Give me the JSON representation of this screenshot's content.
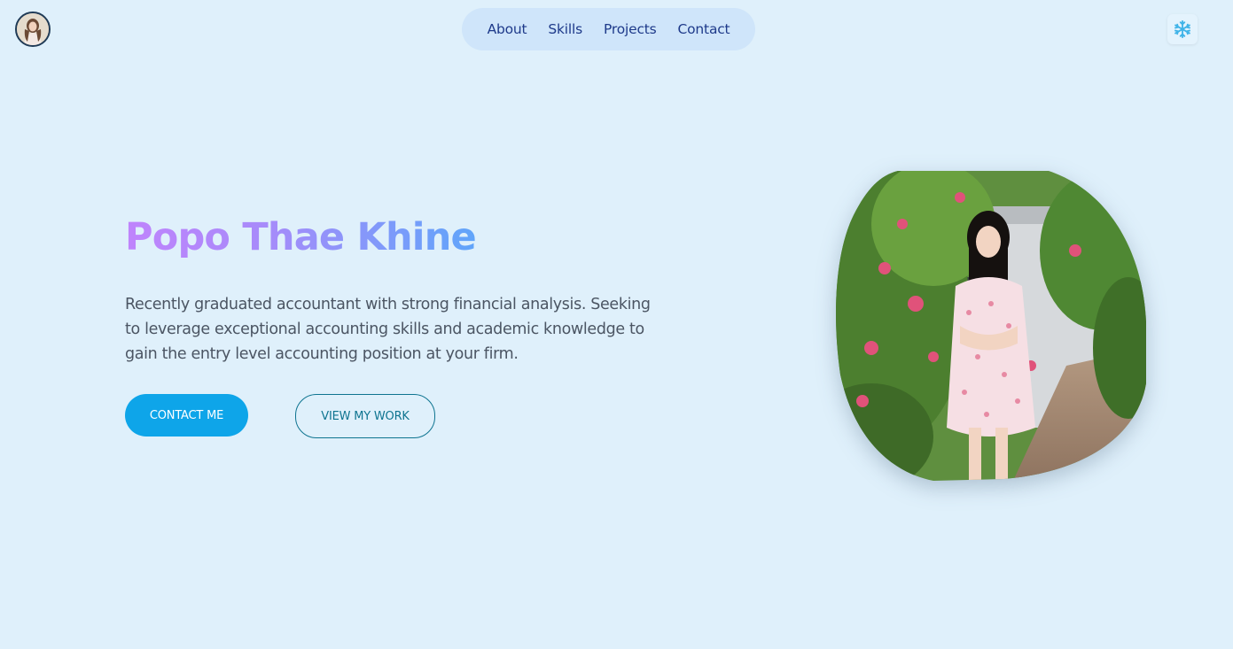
{
  "header": {
    "nav": {
      "items": [
        {
          "label": "About"
        },
        {
          "label": "Skills"
        },
        {
          "label": "Projects"
        },
        {
          "label": "Contact"
        }
      ]
    },
    "theme_toggle_icon": "snowflake-icon",
    "avatar_icon": "avatar"
  },
  "hero": {
    "name": "Popo Thae Khine",
    "description": "Recently graduated accountant with strong financial analysis. Seeking to leverage exceptional accounting skills and academic knowledge to gain the entry level accounting position at your firm.",
    "primary_button": "CONTACT ME",
    "secondary_button": "VIEW MY WORK"
  },
  "colors": {
    "background": "#dff0fb",
    "nav_background": "#cfe5fa",
    "nav_text": "#1e3a8a",
    "primary_button": "#0ea5e9",
    "outline_button": "#0e7490",
    "name_gradient_start": "#c084fc",
    "name_gradient_end": "#60a5fa",
    "description_text": "#4b5563"
  }
}
